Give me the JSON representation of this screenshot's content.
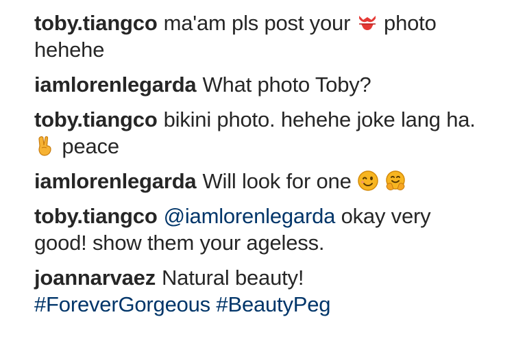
{
  "comments": [
    {
      "username": "toby.tiangco",
      "text_before": "ma'am pls post your",
      "emoji": "bikini-icon",
      "text_after": "photo hehehe"
    },
    {
      "username": "iamlorenlegarda",
      "text": "What photo Toby?"
    },
    {
      "username": "toby.tiangco",
      "text_before": "bikini photo. hehehe joke lang ha.",
      "emoji": "victory-hand-icon",
      "text_after": "peace"
    },
    {
      "username": "iamlorenlegarda",
      "text": "Will look for one",
      "emojis": [
        "winking-face-icon",
        "hugging-face-icon"
      ]
    },
    {
      "username": "toby.tiangco",
      "mention": "@iamlorenlegarda",
      "text": "okay very good! show them your ageless."
    },
    {
      "username": "joannarvaez",
      "text": "Natural beauty!",
      "hashtags": [
        "#ForeverGorgeous",
        "#BeautyPeg"
      ]
    }
  ],
  "colors": {
    "text": "#262626",
    "link": "#003569",
    "background": "#ffffff"
  }
}
